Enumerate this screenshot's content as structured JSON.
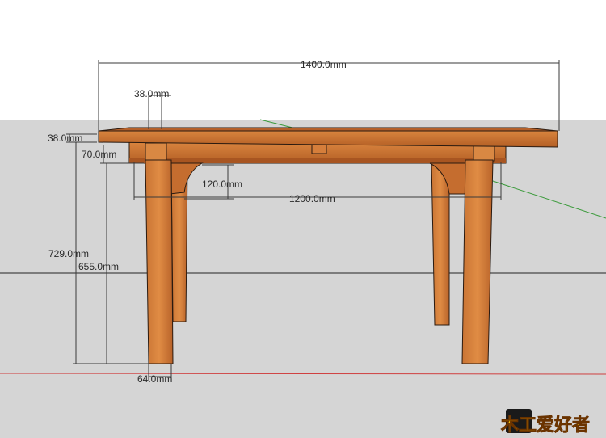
{
  "dimensions": {
    "total_length": "1400.0mm",
    "top_thickness": "38.0mm",
    "corner_block": "38.0mm",
    "apron_height": "70.0mm",
    "bracket_height": "120.0mm",
    "leg_span": "1200.0mm",
    "total_height": "729.0mm",
    "leg_height": "655.0mm",
    "leg_width": "64.0mm"
  },
  "logo": {
    "text": "木工爱好者"
  },
  "colors": {
    "sky": "#ffffff",
    "ground": "#d5d5d5",
    "wood": "#c0692c",
    "wood_dark": "#8a4214",
    "axis_red": "#d04040",
    "axis_green": "#3a9a3a"
  }
}
